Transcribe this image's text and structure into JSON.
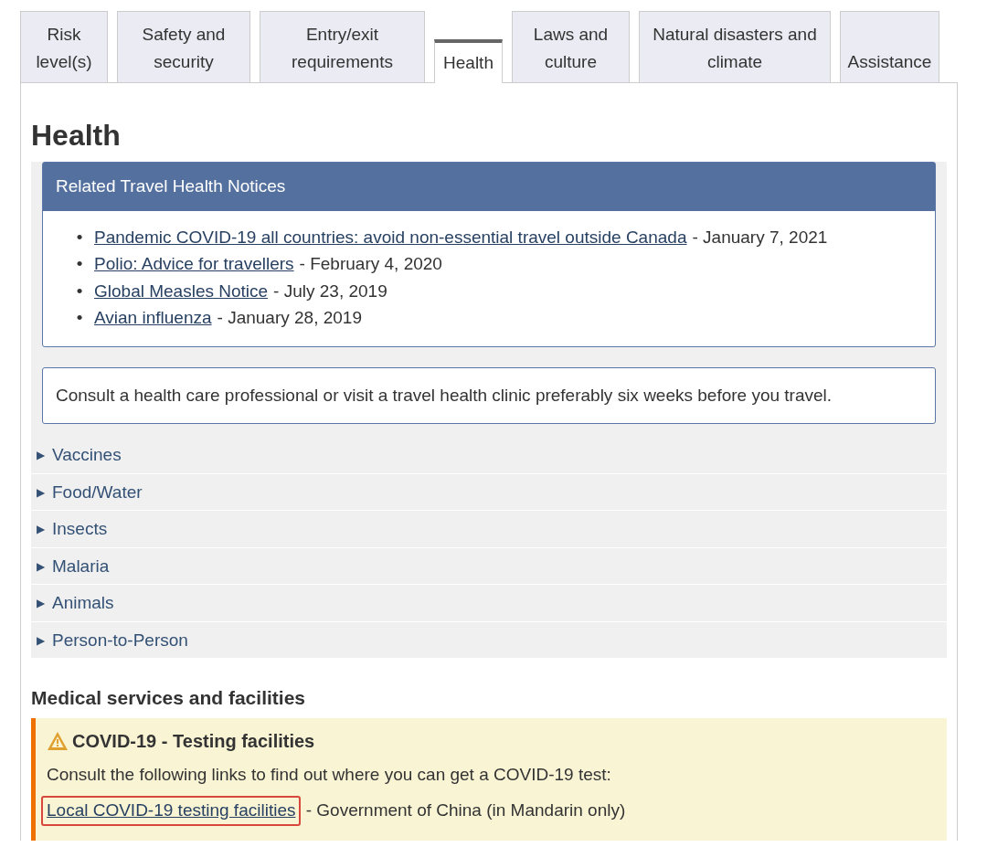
{
  "tabs": [
    {
      "label": "Risk level(s)",
      "selected": false
    },
    {
      "label": "Safety and security",
      "selected": false
    },
    {
      "label": "Entry/exit requirements",
      "selected": false
    },
    {
      "label": "Health",
      "selected": true
    },
    {
      "label": "Laws and culture",
      "selected": false
    },
    {
      "label": "Natural disasters and climate",
      "selected": false
    },
    {
      "label": "Assistance",
      "selected": false
    }
  ],
  "heading": "Health",
  "notices": {
    "title": "Related Travel Health Notices",
    "items": [
      {
        "bullet": "•",
        "link": "Pandemic COVID-19 all countries: avoid non-essential travel outside Canada",
        "date": "- January 7, 2021"
      },
      {
        "bullet": "•",
        "link": "Polio: Advice for travellers",
        "date": "- February 4, 2020"
      },
      {
        "bullet": "•",
        "link": "Global Measles Notice",
        "date": "- July 23, 2019"
      },
      {
        "bullet": "•",
        "link": "Avian influenza",
        "date": "- January 28, 2019"
      }
    ]
  },
  "advice": "Consult a health care professional or visit a travel health clinic preferably six weeks before you travel.",
  "sections": [
    {
      "marker": "▶",
      "label": "Vaccines",
      "expanded": false
    },
    {
      "marker": "▶",
      "label": "Food/Water",
      "expanded": false
    },
    {
      "marker": "▶",
      "label": "Insects",
      "expanded": false
    },
    {
      "marker": "▶",
      "label": "Malaria",
      "expanded": false
    },
    {
      "marker": "▶",
      "label": "Animals",
      "expanded": false
    },
    {
      "marker": "▶",
      "label": "Person-to-Person",
      "expanded": false
    }
  ],
  "medical": {
    "heading": "Medical services and facilities",
    "alert": {
      "title": "COVID-19 - Testing facilities",
      "text": "Consult the following links to find out where you can get a COVID-19 test:",
      "link": "Local COVID-19 testing facilities",
      "highlighted": true,
      "after": "- Government of China (in Mandarin only)"
    }
  }
}
